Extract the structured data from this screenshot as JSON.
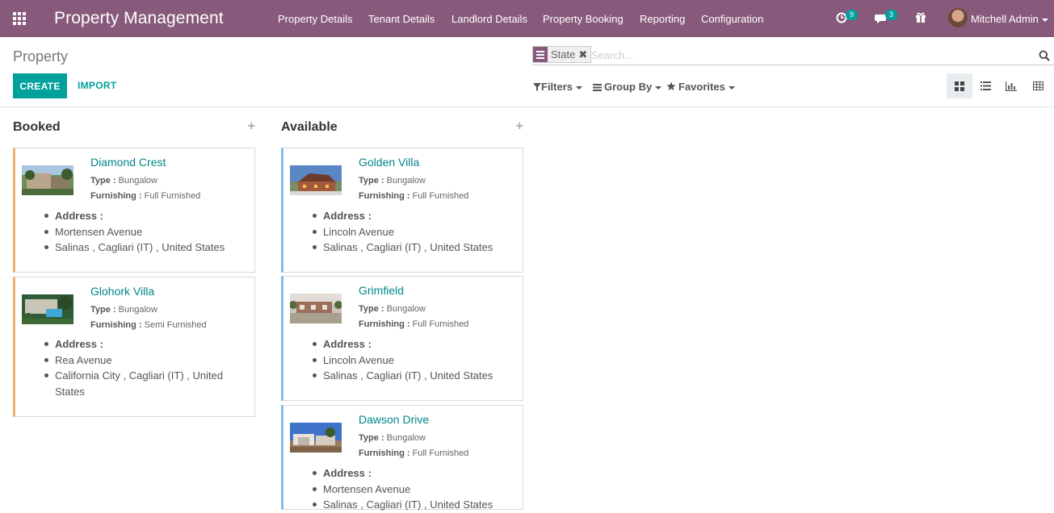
{
  "navbar": {
    "brand": "Property Management",
    "menu": [
      "Property Details",
      "Tenant Details",
      "Landlord Details",
      "Property Booking",
      "Reporting",
      "Configuration"
    ],
    "activity_count": "9",
    "messages_count": "3",
    "user_name": "Mitchell Admin"
  },
  "control_panel": {
    "breadcrumb": "Property",
    "create_label": "CREATE",
    "import_label": "IMPORT",
    "facet_label": "State",
    "search_placeholder": "Search...",
    "filters_label": "Filters",
    "groupby_label": "Group By",
    "favorites_label": "Favorites"
  },
  "kanban": {
    "columns": [
      {
        "title": "Booked",
        "cards": [
          {
            "name": "Diamond Crest",
            "type_label": "Type :",
            "type": "Bungalow",
            "furnishing_label": "Furnishing :",
            "furnishing": "Full Furnished",
            "address_label": "Address :",
            "street": "Mortensen Avenue",
            "city_line": "Salinas , Cagliari (IT) , United States"
          },
          {
            "name": "Glohork Villa",
            "type_label": "Type :",
            "type": "Bungalow",
            "furnishing_label": "Furnishing :",
            "furnishing": "Semi Furnished",
            "address_label": "Address :",
            "street": "Rea Avenue",
            "city_line": "California City , Cagliari (IT) , United States"
          }
        ]
      },
      {
        "title": "Available",
        "cards": [
          {
            "name": "Golden Villa",
            "type_label": "Type :",
            "type": "Bungalow",
            "furnishing_label": "Furnishing :",
            "furnishing": "Full Furnished",
            "address_label": "Address :",
            "street": "Lincoln Avenue",
            "city_line": "Salinas , Cagliari (IT) , United States"
          },
          {
            "name": "Grimfield",
            "type_label": "Type :",
            "type": "Bungalow",
            "furnishing_label": "Furnishing :",
            "furnishing": "Full Furnished",
            "address_label": "Address :",
            "street": "Lincoln Avenue",
            "city_line": "Salinas , Cagliari (IT) , United States"
          },
          {
            "name": "Dawson Drive",
            "type_label": "Type :",
            "type": "Bungalow",
            "furnishing_label": "Furnishing :",
            "furnishing": "Full Furnished",
            "address_label": "Address :",
            "street": "Mortensen Avenue",
            "city_line": "Salinas , Cagliari (IT) , United States"
          }
        ]
      }
    ]
  },
  "colors": {
    "navbar": "#875a7b",
    "primary": "#00a09d",
    "booked_border": "#f0ad6f",
    "available_border": "#7fbee8"
  }
}
